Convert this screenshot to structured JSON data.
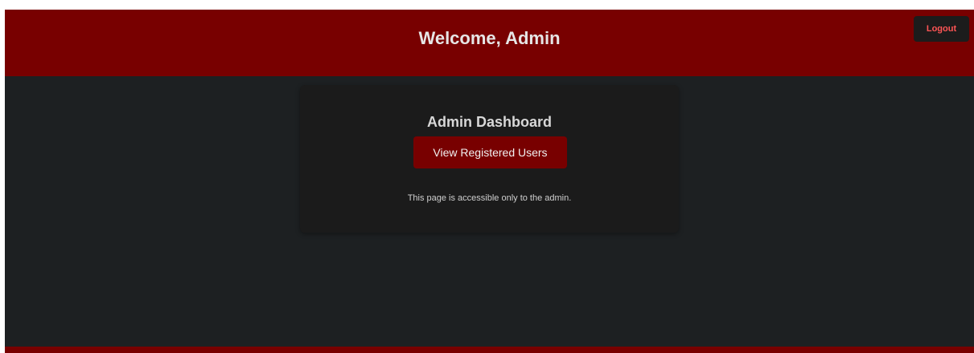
{
  "header": {
    "title": "Welcome, Admin",
    "logout_label": "Logout"
  },
  "card": {
    "title": "Admin Dashboard",
    "view_users_label": "View Registered Users",
    "note": "This page is accessible only to the admin."
  },
  "colors": {
    "brand": "#780000",
    "background": "#1d2022",
    "card": "#1b1b1b",
    "logout_text": "#ff5555"
  }
}
